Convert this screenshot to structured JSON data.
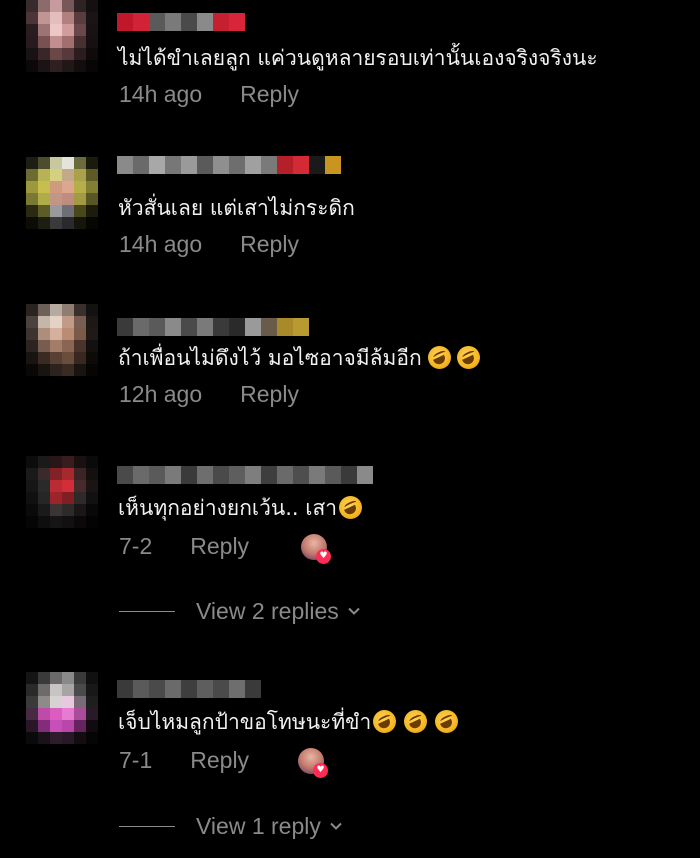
{
  "comments": [
    {
      "text": "ไม่ได้ขำเลยลูก แค่วนดูหลายรอบเท่านั้นเองจริงจริงนะ",
      "emoji_count": 0,
      "time": "14h ago",
      "reply_label": "Reply",
      "avatar_colors": [
        "#3a2a2e",
        "#8f6a6c",
        "#c99a9c",
        "#7a5658",
        "#2e2224",
        "#141012",
        "#4d3436",
        "#c79393",
        "#e7bdbb",
        "#b5807f",
        "#5c3c3e",
        "#1c1416",
        "#2b1d20",
        "#a27273",
        "#efc6c4",
        "#d59b9b",
        "#6d4749",
        "#1a1214",
        "#281b1d",
        "#7b5051",
        "#c88d8d",
        "#a66d6e",
        "#4a2f31",
        "#171012",
        "#1a1214",
        "#3a2628",
        "#6e4647",
        "#5a383a",
        "#2c1c1e",
        "#100a0b",
        "#0c0809",
        "#1d1314",
        "#301f20",
        "#231718",
        "#140d0e",
        "#080506"
      ],
      "username_colors": [
        "#c0182a",
        "#d12236",
        "#5a5a5a",
        "#7a7a7a",
        "#4a4a4a",
        "#8a8a8a",
        "#c4202f",
        "#d9253a"
      ]
    },
    {
      "text": "หัวสั่นเลย แต่เสาไม่กระดิก",
      "emoji_count": 0,
      "time": "14h ago",
      "reply_label": "Reply",
      "avatar_colors": [
        "#1d1d10",
        "#4d4d2a",
        "#c8c89a",
        "#e4e4dc",
        "#6a6a38",
        "#1a1a0c",
        "#6d6c2a",
        "#b8b44a",
        "#d6cf7a",
        "#c7a886",
        "#aaa342",
        "#5e5a20",
        "#9c9a32",
        "#c7c044",
        "#d39a7a",
        "#e0a68a",
        "#b7b03e",
        "#837e2c",
        "#7a7a2c",
        "#b1ad40",
        "#c79482",
        "#c48c7c",
        "#a39c3a",
        "#5a5620",
        "#2a2a10",
        "#5d5c24",
        "#9a9a9e",
        "#6e6e78",
        "#4a4818",
        "#1c1c0a",
        "#0c0c06",
        "#1d1d10",
        "#3a3a3c",
        "#2a2a2e",
        "#151508",
        "#060603"
      ],
      "username_colors": [
        "#8a8a8a",
        "#6a6a6a",
        "#a8a8a8",
        "#777",
        "#9a9a9a",
        "#5a5a5a",
        "#8f8f8f",
        "#6e6e6e",
        "#a0a0a0",
        "#7a7a7a",
        "#b41f2a",
        "#d42a35",
        "#1a1a1a",
        "#c89620"
      ]
    },
    {
      "text": "ถ้าเพื่อนไม่ดึงไว้ มอไซอาจมีล้มอีก",
      "emoji_count": 2,
      "time": "12h ago",
      "reply_label": "Reply",
      "avatar_colors": [
        "#2a2420",
        "#6e6058",
        "#b8aaa0",
        "#8e7d70",
        "#3a302a",
        "#141210",
        "#4d423c",
        "#c8b6a8",
        "#e6d2c4",
        "#c59a84",
        "#7a5e50",
        "#1d1816",
        "#3e342e",
        "#b08c7a",
        "#d8b09a",
        "#c08a70",
        "#7d5a48",
        "#201a16",
        "#2c2420",
        "#7a5c4c",
        "#a87c66",
        "#8e6450",
        "#4a3428",
        "#141010",
        "#181412",
        "#3a2a22",
        "#5c4032",
        "#6e4c3a",
        "#3a2820",
        "#0e0a08",
        "#0a0807",
        "#1a1410",
        "#2e221c",
        "#3a2a22",
        "#1a1410",
        "#060504"
      ],
      "username_colors": [
        "#3a3a3a",
        "#6a6a6a",
        "#5a5a5a",
        "#8a8a8a",
        "#4a4a4a",
        "#7a7a7a",
        "#3a3a3a",
        "#2a2a2a",
        "#9a9a9a",
        "#6a5a4a",
        "#a88a2a",
        "#b89a30"
      ]
    },
    {
      "text": "เห็นทุกอย่างยกเว้น.. เสา",
      "emoji_count": 1,
      "time": "7-2",
      "reply_label": "Reply",
      "creator_liked": true,
      "view_replies": "View 2 replies",
      "avatar_colors": [
        "#0c0c0c",
        "#1a1a1a",
        "#2a1618",
        "#3a1c1e",
        "#1a1010",
        "#0a0a0a",
        "#1a1a1a",
        "#3a2a2c",
        "#8a2024",
        "#b2262c",
        "#3e2224",
        "#141010",
        "#161616",
        "#2a2a2a",
        "#c82830",
        "#e02a34",
        "#4a2a2c",
        "#1a1414",
        "#101010",
        "#262626",
        "#a82228",
        "#8a1c22",
        "#2e2a2a",
        "#121010",
        "#0a0a0a",
        "#1a1a1a",
        "#3a3434",
        "#2e2a2a",
        "#1a1616",
        "#080808",
        "#050505",
        "#0e0e0e",
        "#161414",
        "#121010",
        "#0a0808",
        "#030303"
      ],
      "username_colors": [
        "#4a4a4a",
        "#6a6a6a",
        "#5a5a5a",
        "#7a7a7a",
        "#3a3a3a",
        "#6e6e6e",
        "#4a4a4a",
        "#5e5e5e",
        "#7e7e7e",
        "#3e3e3e",
        "#6a6a6a",
        "#4e4e4e",
        "#7a7a7a",
        "#5a5a5a",
        "#3a3a3a",
        "#8a8a8a"
      ]
    },
    {
      "text": "เจ็บไหมลูกป้าขอโทษนะที่ขำ",
      "emoji_count": 3,
      "time": "7-1",
      "reply_label": "Reply",
      "creator_liked": true,
      "view_replies": "View 1 reply",
      "avatar_colors": [
        "#141414",
        "#3a3a3a",
        "#6a6a6a",
        "#8a8a8a",
        "#3a3a3a",
        "#101010",
        "#2a2a2a",
        "#6e6a6a",
        "#c8c4c4",
        "#a8a4a4",
        "#4a4a4a",
        "#181818",
        "#3a3a3a",
        "#8e8a8a",
        "#d6d2d2",
        "#e8c8e0",
        "#7a6a78",
        "#1e1e1e",
        "#4a2a44",
        "#c848b0",
        "#e858c8",
        "#f078d8",
        "#b04aa0",
        "#2a1a28",
        "#2a1628",
        "#8a2a80",
        "#d04cc0",
        "#c242b0",
        "#6a2262",
        "#140a12",
        "#0a0a0a",
        "#1a1218",
        "#301a2c",
        "#2a1828",
        "#140c12",
        "#050505"
      ],
      "username_colors": [
        "#3a3a3a",
        "#5a5a5a",
        "#4a4a4a",
        "#6a6a6a",
        "#3e3e3e",
        "#5e5e5e",
        "#4a4a4a",
        "#6e6e6e",
        "#3a3a3a"
      ]
    }
  ]
}
